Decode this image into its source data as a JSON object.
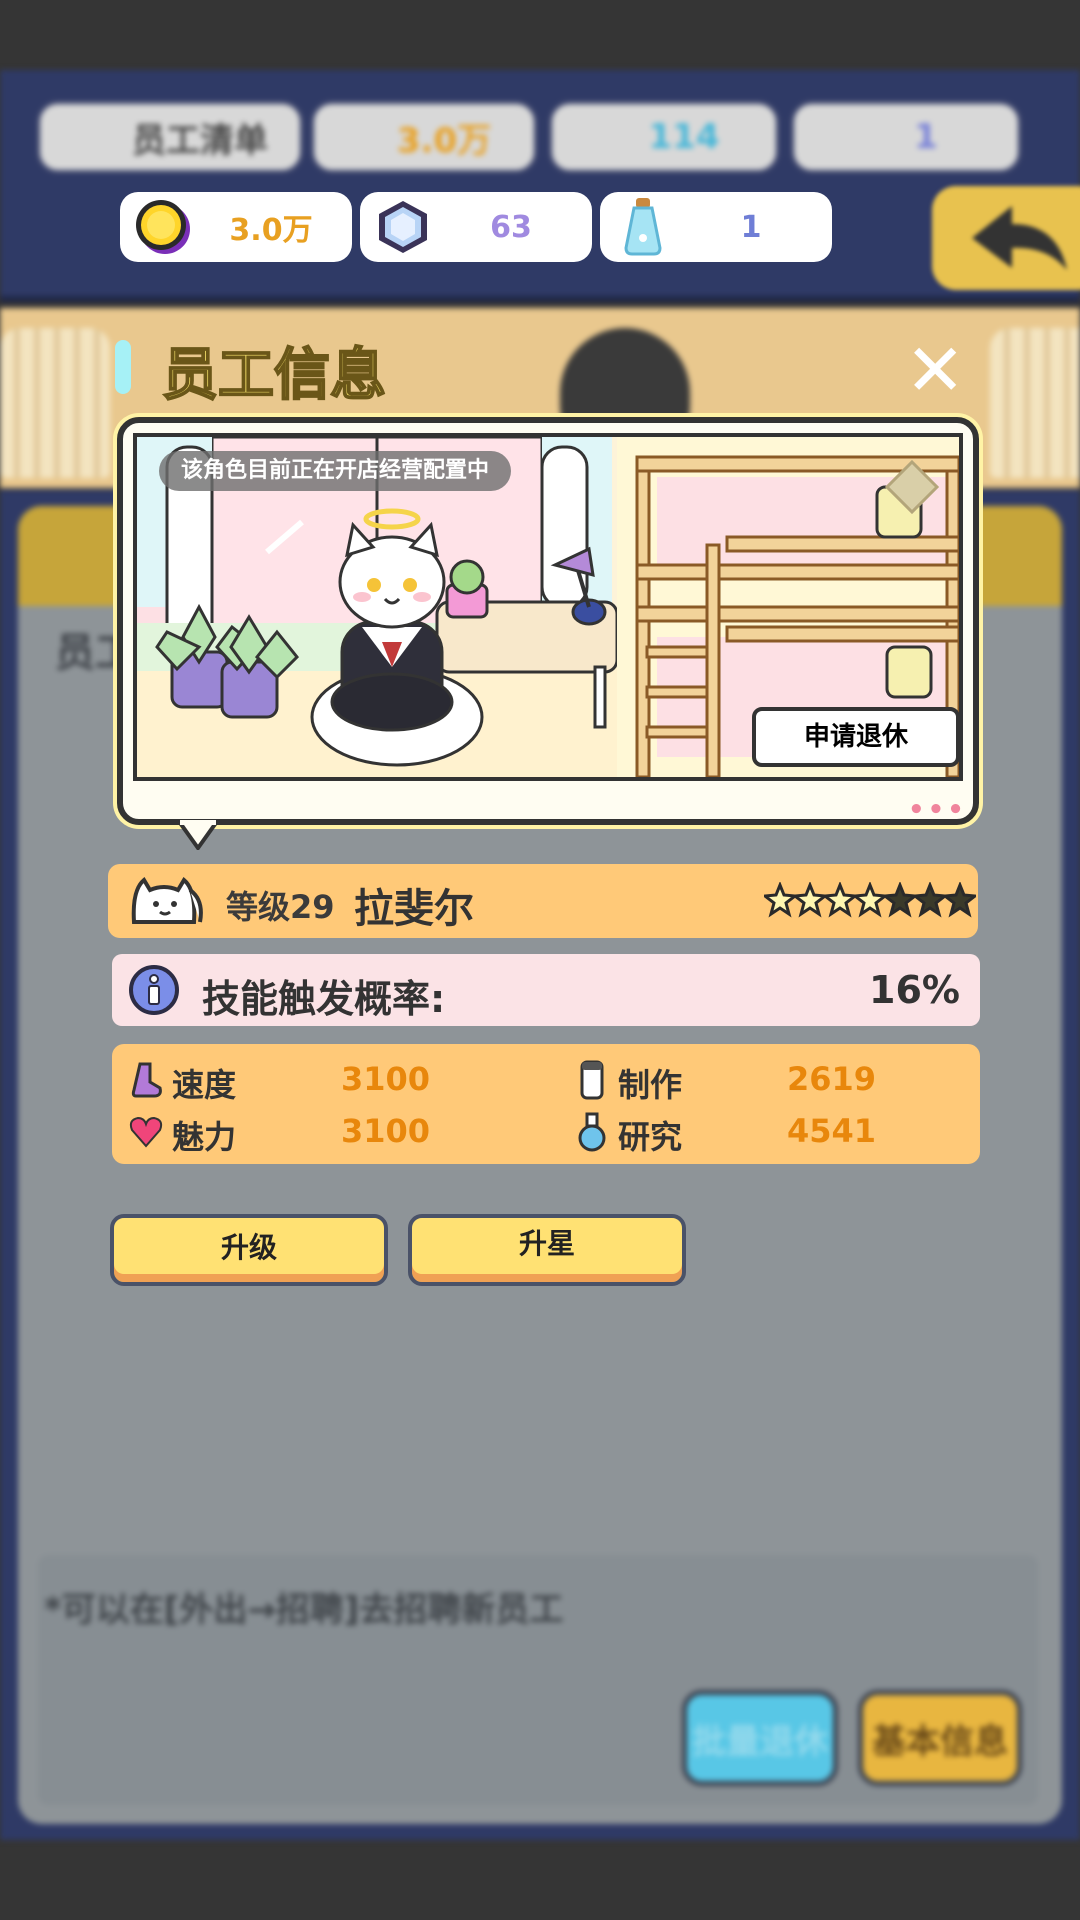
{
  "background": {
    "top_resources": [
      {
        "icon": "coin-icon",
        "value": "3.0万",
        "color": "#e8a021"
      },
      {
        "icon": "potion-icon",
        "value": "114",
        "color": "#48b7d8"
      },
      {
        "icon": "bottle-icon",
        "value": "1",
        "color": "#7a83d8"
      }
    ],
    "staff_list_label": "员工清单",
    "section_label": "员工",
    "hint": "*可以在[外出→招聘]去招聘新员工",
    "batch_retire_label": "批量退休",
    "basic_info_label": "基本信息"
  },
  "resources": [
    {
      "icon": "coin-icon",
      "value": "3.0万",
      "color": "#e8a021"
    },
    {
      "icon": "crystal-icon",
      "value": "63",
      "color": "#a08ae0"
    },
    {
      "icon": "bottle-icon",
      "value": "1",
      "color": "#6f7ed6"
    }
  ],
  "dialog": {
    "title": "员工信息",
    "close_icon": "close-icon",
    "scene": {
      "status": "该角色目前正在开店经营配置中",
      "retire_label": "申请退休",
      "more": "•••"
    },
    "employee": {
      "level": "等级29",
      "name": "拉斐尔",
      "stars_filled": 4,
      "stars_total": 7
    },
    "skill": {
      "label": "技能触发概率:",
      "value": "16%"
    },
    "stats": [
      {
        "icon": "boot-icon",
        "label": "速度",
        "value": "3100"
      },
      {
        "icon": "cup-icon",
        "label": "制作",
        "value": "2619"
      },
      {
        "icon": "heart-icon",
        "label": "魅力",
        "value": "3100"
      },
      {
        "icon": "flask-icon",
        "label": "研究",
        "value": "4541"
      }
    ],
    "upgrade_label": "升级",
    "star_up_label": "升星"
  }
}
